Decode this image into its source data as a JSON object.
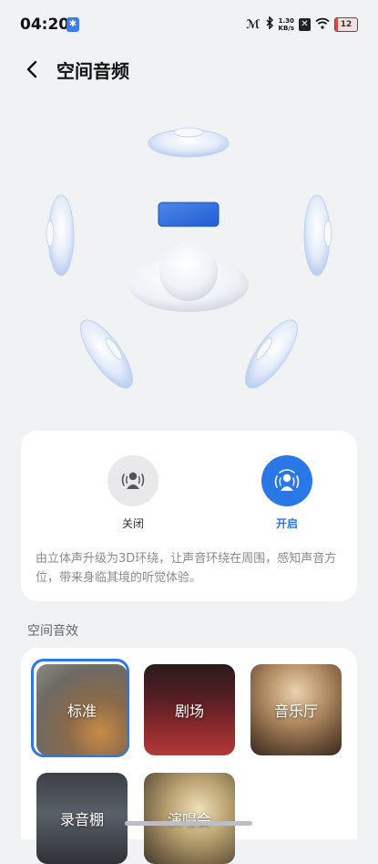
{
  "status_bar": {
    "time": "04:20",
    "bluetooth_badge": "✱",
    "network_label": "ℳ",
    "speed_value": "1.30",
    "speed_unit": "KB/s",
    "battery_level": "12"
  },
  "header": {
    "title": "空间音频"
  },
  "mode": {
    "off_label": "关闭",
    "on_label": "开启",
    "selected": "on",
    "description": "由立体声升级为3D环绕，让声音环绕在周围，感知声音方位，带来身临其境的听觉体验。"
  },
  "effects": {
    "section_label": "空间音效",
    "selected": "标准",
    "items": [
      {
        "label": "标准"
      },
      {
        "label": "剧场"
      },
      {
        "label": "音乐厅"
      },
      {
        "label": "录音棚"
      },
      {
        "label": "演唱会"
      }
    ]
  },
  "colors": {
    "accent": "#2a78e8",
    "background": "#f1f2f4",
    "card": "#ffffff"
  },
  "icons": {
    "back": "chevron-left-icon",
    "mode_off": "person-speaker-off-icon",
    "mode_on": "person-speaker-on-icon"
  }
}
